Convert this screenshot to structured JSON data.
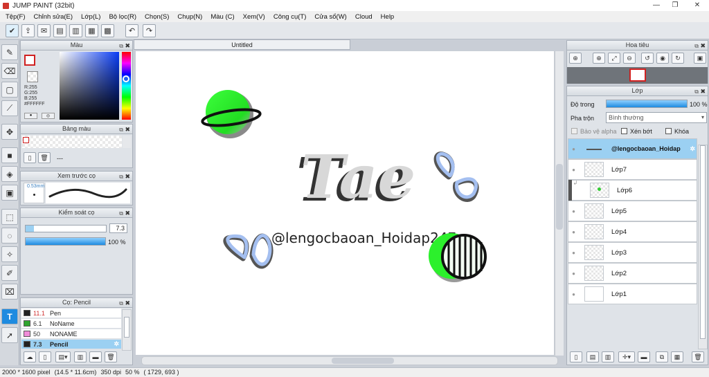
{
  "app": {
    "title": "JUMP PAINT (32bit)"
  },
  "menu": [
    "Tệp(F)",
    "Chỉnh sửa(E)",
    "Lớp(L)",
    "Bộ lọc(R)",
    "Chọn(S)",
    "Chụp(N)",
    "Màu (C)",
    "Xem(V)",
    "Công cụ(T)",
    "Cửa sổ(W)",
    "Cloud",
    "Help"
  ],
  "document": {
    "tab": "Untitled"
  },
  "color_panel": {
    "title": "Màu",
    "r": "R:255",
    "g": "G:255",
    "b": "B:255",
    "hex": "#FFFFFF"
  },
  "palette_panel": {
    "title": "Bảng màu",
    "value": "---"
  },
  "brush_preview": {
    "title": "Xem trước cọ",
    "size": "0.53mm"
  },
  "brush_control": {
    "title": "Kiểm soát cọ",
    "size": "7.3",
    "opacity": "100 %",
    "opacity_fraction": 1.0,
    "size_fraction": 0.1
  },
  "brush_list": {
    "title": "Cọ: Pencil",
    "items": [
      {
        "size": "11.1",
        "name": "Pen",
        "color": "#222222",
        "size_color": "#d03030"
      },
      {
        "size": "6.1",
        "name": "NoName",
        "color": "#2fa52f",
        "size_color": "#333333"
      },
      {
        "size": "50",
        "name": "NONAME",
        "color": "#f08cd8",
        "size_color": "#333333"
      },
      {
        "size": "7.3",
        "name": "Pencil",
        "color": "#222222",
        "size_color": "#111111",
        "selected": true
      }
    ]
  },
  "navigator": {
    "title": "Hoa tiêu"
  },
  "layer_panel": {
    "title": "Lớp",
    "opacity_label": "Độ trong",
    "opacity_value": "100 %",
    "opacity_fraction": 1.0,
    "blend_label": "Pha trộn",
    "blend_value": "Bình thường",
    "protect_alpha": "Bảo vệ alpha",
    "clipping": "Xén bớt",
    "lock": "Khóa",
    "layers": [
      {
        "name": "@lengocbaoan_Hoidap",
        "selected": true
      },
      {
        "name": "Lớp7"
      },
      {
        "name": "Lớp6"
      },
      {
        "name": "Lớp5"
      },
      {
        "name": "Lớp4"
      },
      {
        "name": "Lớp3"
      },
      {
        "name": "Lớp2"
      },
      {
        "name": "Lớp1"
      }
    ]
  },
  "artwork": {
    "main_text": "Tae",
    "handle_text": "@lengocbaoan_Hoidap247"
  },
  "status": {
    "size_px": "2000 * 1600 pixel",
    "size_cm": "(14.5 * 11.6cm)",
    "dpi": "350 dpi",
    "zoom": "50 %",
    "cursor": "( 1729, 693 )"
  },
  "colors": {
    "accent": "#7ab8e6",
    "selected": "#9bd0f2",
    "panel": "#dfe3e8"
  }
}
